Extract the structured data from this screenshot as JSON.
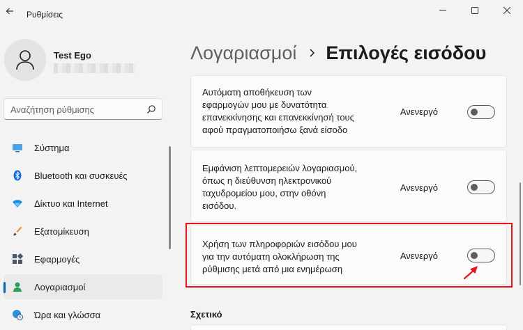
{
  "app": {
    "title": "Ρυθμίσεις"
  },
  "user": {
    "name": "Test Ego"
  },
  "search": {
    "placeholder": "Αναζήτηση ρύθμισης"
  },
  "nav": {
    "items": [
      {
        "label": "Σύστημα",
        "icon": "monitor-icon"
      },
      {
        "label": "Bluetooth και συσκευές",
        "icon": "bluetooth-icon"
      },
      {
        "label": "Δίκτυο και Internet",
        "icon": "wifi-icon"
      },
      {
        "label": "Εξατομίκευση",
        "icon": "brush-icon"
      },
      {
        "label": "Εφαρμογές",
        "icon": "apps-icon"
      },
      {
        "label": "Λογαριασμοί",
        "icon": "person-icon",
        "active": true
      },
      {
        "label": "Ώρα και γλώσσα",
        "icon": "clock-globe-icon"
      }
    ]
  },
  "breadcrumb": {
    "parent": "Λογαριασμοί",
    "current": "Επιλογές εισόδου"
  },
  "settings": [
    {
      "lines": [
        "Αυτόματη αποθήκευση των",
        "εφαρμογών μου με δυνατότητα",
        "επανεκκίνησης και επανεκκίνησή τους",
        "αφού πραγματοποιήσω ξανά είσοδο"
      ],
      "status": "Ανενεργό",
      "on": false
    },
    {
      "lines": [
        "Εμφάνιση λεπτομερειών λογαριασμού,",
        "όπως η διεύθυνση ηλεκτρονικού",
        "ταχυδρομείου μου, στην οθόνη",
        "εισόδου."
      ],
      "status": "Ανενεργό",
      "on": false
    },
    {
      "lines": [
        "Χρήση των πληροφοριών εισόδου μου",
        "για την αυτόματη ολοκλήρωση της",
        "ρύθμισης μετά από μια ενημέρωση"
      ],
      "status": "Ανενεργό",
      "on": false
    }
  ],
  "related": {
    "heading": "Σχετικό"
  },
  "colors": {
    "accent": "#005fb8",
    "highlight": "#e8121c"
  }
}
